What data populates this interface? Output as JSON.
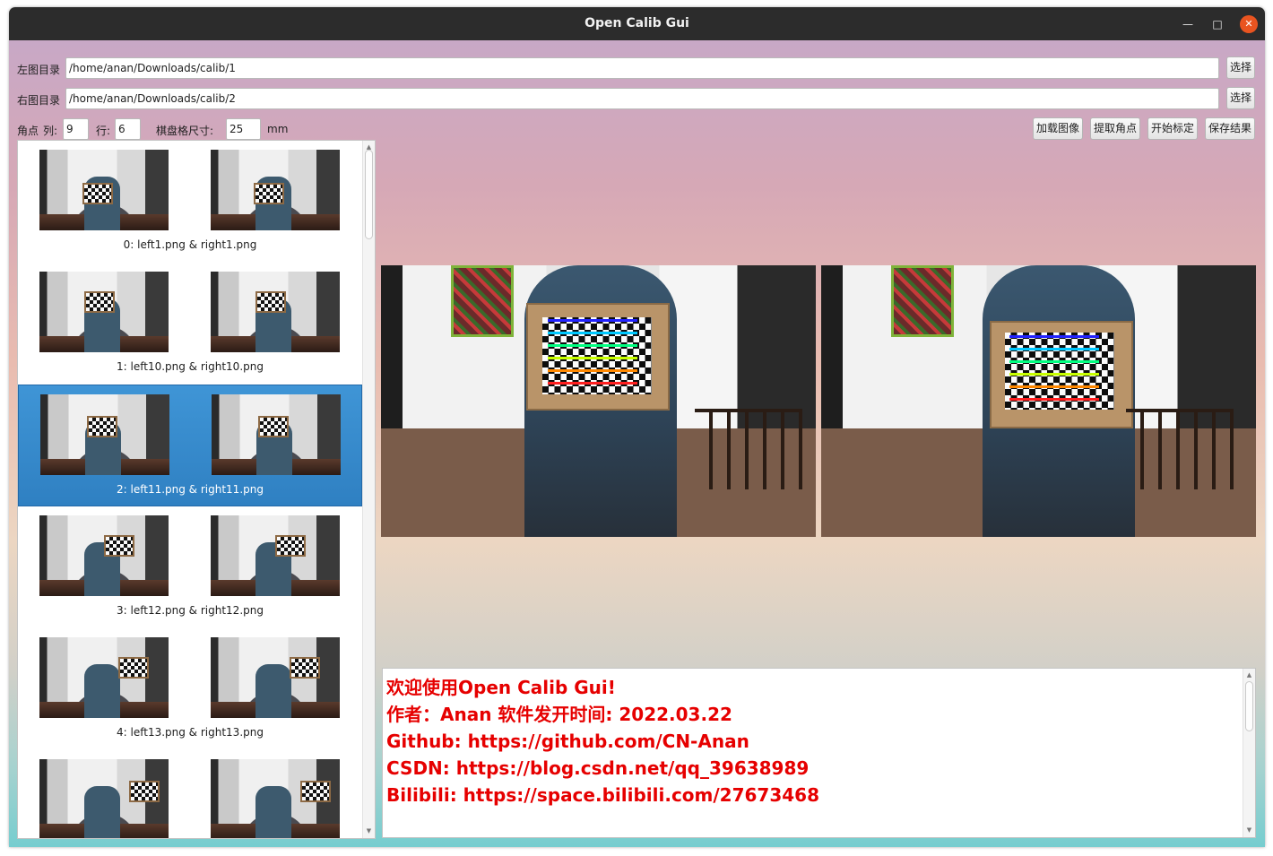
{
  "window": {
    "title": "Open Calib Gui"
  },
  "controls": {
    "left_dir_label": "左图目录",
    "left_dir_value": "/home/anan/Downloads/calib/1",
    "right_dir_label": "右图目录",
    "right_dir_value": "/home/anan/Downloads/calib/2",
    "choose_label": "选择",
    "corner_label": "角点",
    "cols_label": "列:",
    "cols_value": "9",
    "rows_label": "行:",
    "rows_value": "6",
    "square_label": "棋盘格尺寸:",
    "square_value": "25",
    "unit": "mm",
    "load_button": "加载图像",
    "extract_button": "提取角点",
    "calibrate_button": "开始标定",
    "save_button": "保存结果"
  },
  "image_list": {
    "selected_index": 2,
    "items": [
      {
        "caption": "0:  left1.png  &  right1.png"
      },
      {
        "caption": "1:  left10.png  &  right10.png"
      },
      {
        "caption": "2:  left11.png  &  right11.png"
      },
      {
        "caption": "3:  left12.png  &  right12.png"
      },
      {
        "caption": "4:  left13.png  &  right13.png"
      },
      {
        "caption": ""
      }
    ]
  },
  "console": {
    "lines": [
      "欢迎使用Open Calib Gui!",
      "作者：Anan   软件发开时间: 2022.03.22",
      "Github:   https://github.com/CN-Anan",
      "CSDN:    https://blog.csdn.net/qq_39638989",
      "Bilibili: https://space.bilibili.com/27673468"
    ],
    "text_color": "#e60000"
  },
  "colors": {
    "selection": "#3c8ed0",
    "titlebar": "#2c2c2c",
    "close_button": "#e95420"
  }
}
